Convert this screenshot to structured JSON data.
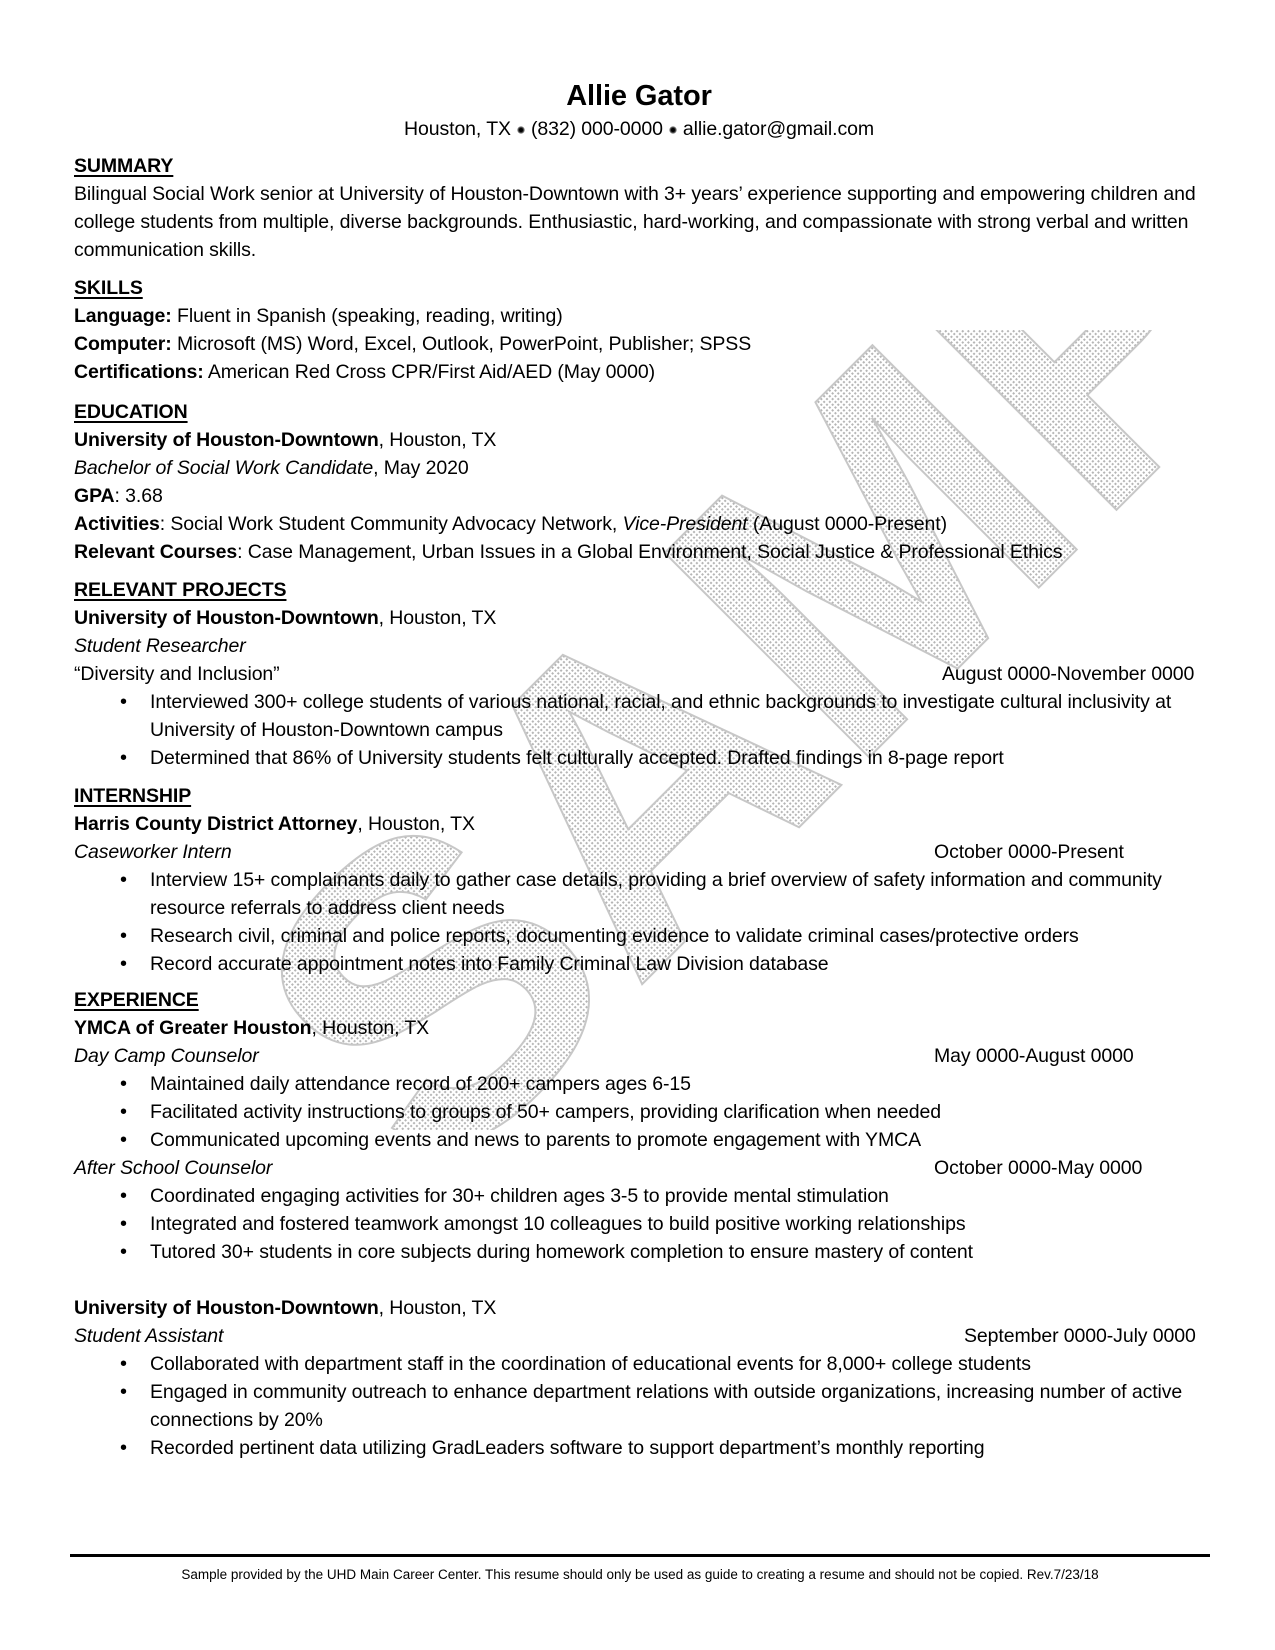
{
  "header": {
    "name": "Allie Gator",
    "location": "Houston, TX",
    "phone": "(832) 000-0000",
    "email": "allie.gator@gmail.com"
  },
  "summary": {
    "heading": "SUMMARY",
    "text": "Bilingual Social Work senior at University of Houston-Downtown with 3+ years’ experience supporting and empowering children and college students from multiple, diverse backgrounds. Enthusiastic, hard-working, and compassionate with strong verbal and written communication skills."
  },
  "skills": {
    "heading": "SKILLS",
    "items": [
      {
        "label": "Language:",
        "value": " Fluent in Spanish (speaking, reading, writing)"
      },
      {
        "label": "Computer:",
        "value": " Microsoft (MS) Word, Excel, Outlook, PowerPoint, Publisher; SPSS"
      },
      {
        "label": "Certifications:",
        "value": " American Red Cross CPR/First Aid/AED (May 0000)"
      }
    ]
  },
  "education": {
    "heading": "EDUCATION",
    "school": "University of Houston-Downtown",
    "school_location": ", Houston, TX",
    "degree": "Bachelor of Social Work Candidate",
    "degree_date": ", May 2020",
    "gpa_label": "GPA",
    "gpa_value": ": 3.68",
    "activities_label": "Activities",
    "activities_value": ": Social Work Student Community Advocacy Network, ",
    "activities_role": "Vice-President",
    "activities_date": " (August 0000-Present)",
    "courses_label": "Relevant Courses",
    "courses_value": ": Case Management, Urban Issues in a Global Environment, Social Justice & Professional Ethics"
  },
  "projects": {
    "heading": "RELEVANT PROJECTS",
    "org": "University of Houston-Downtown",
    "org_location": ", Houston, TX",
    "role": "Student Researcher",
    "project": "“Diversity and Inclusion”",
    "date": "August 0000-November 0000",
    "bullets": [
      "Interviewed 300+ college students of various national, racial, and ethnic backgrounds to investigate cultural inclusivity at University of Houston-Downtown campus",
      "Determined that 86% of University students felt culturally accepted. Drafted findings in 8-page report"
    ]
  },
  "internship": {
    "heading": "INTERNSHIP",
    "org": "Harris County District Attorney",
    "org_location": ", Houston, TX",
    "role": "Caseworker Intern",
    "date": "October 0000-Present",
    "bullets": [
      "Interview 15+ complainants daily to gather case details, providing a brief overview of safety information and community resource referrals to address client needs",
      "Research civil, criminal and police reports, documenting evidence to validate criminal cases/protective orders",
      "Record accurate appointment notes into Family Criminal Law Division database"
    ]
  },
  "experience": {
    "heading": "EXPERIENCE",
    "jobs": [
      {
        "org": "YMCA of Greater Houston",
        "org_location": ", Houston, TX",
        "positions": [
          {
            "role": "Day Camp Counselor",
            "date": "May 0000-August 0000",
            "bullets": [
              "Maintained daily attendance record of 200+ campers ages 6-15",
              "Facilitated activity instructions to groups of 50+ campers, providing clarification when needed",
              "Communicated upcoming events and news to parents to promote engagement with YMCA"
            ]
          },
          {
            "role": "After School Counselor",
            "date": "October 0000-May 0000",
            "bullets": [
              "Coordinated engaging activities for 30+ children ages 3-5 to provide mental stimulation",
              "Integrated and fostered teamwork amongst 10 colleagues to build positive working relationships",
              "Tutored 30+ students in core subjects during homework completion to ensure mastery of content"
            ]
          }
        ]
      },
      {
        "org": "University of Houston-Downtown",
        "org_location": ", Houston, TX",
        "positions": [
          {
            "role": "Student Assistant",
            "date": "September 0000-July 0000",
            "bullets": [
              "Collaborated with department staff in the coordination of educational events for 8,000+ college students",
              "Engaged in community outreach to enhance department relations with outside organizations, increasing number of active connections by 20%",
              "Recorded pertinent data utilizing GradLeaders software to support department’s monthly reporting"
            ]
          }
        ]
      }
    ]
  },
  "watermark": "SAMPLE",
  "footer": "Sample provided by the UHD Main Career Center. This resume should only be used as guide to creating a resume and should not be copied. Rev.7/23/18"
}
